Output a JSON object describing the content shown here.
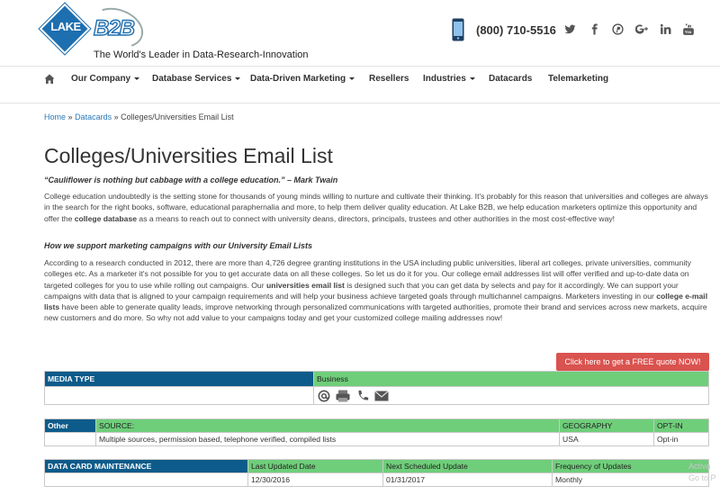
{
  "header": {
    "logo_text": "LAKE",
    "logo_b2b": "B2B",
    "tagline": "The World's Leader in Data-Research-Innovation",
    "phone": "(800) 710-5516",
    "social_icons": [
      "twitter-icon",
      "facebook-icon",
      "pinterest-icon",
      "google-plus-icon",
      "linkedin-icon",
      "youtube-icon"
    ]
  },
  "nav": {
    "items": [
      {
        "label": "Our Company",
        "dropdown": true
      },
      {
        "label": "Database Services",
        "dropdown": true
      },
      {
        "label": "Data-Driven Marketing",
        "dropdown": true
      },
      {
        "label": "Resellers",
        "dropdown": false
      },
      {
        "label": "Industries",
        "dropdown": true
      },
      {
        "label": "Datacards",
        "dropdown": false
      },
      {
        "label": "Telemarketing",
        "dropdown": false
      }
    ]
  },
  "breadcrumb": {
    "home": "Home",
    "sep": "»",
    "datacards": "Datacards",
    "current": "Colleges/Universities Email List"
  },
  "page": {
    "title": "Colleges/Universities Email List",
    "quote": "“Cauliflower is nothing but cabbage with a college education.” – Mark Twain",
    "intro_a": "College education undoubtedly is the setting stone for thousands of young minds willing to nurture and cultivate their thinking. It's probably for this reason that universities and colleges are always in the search for the right books, software, educational paraphernalia and more, to help them deliver quality education. At Lake B2B, we help education marketers optimize this opportunity and offer the ",
    "intro_bold": "college database",
    "intro_b": " as a means to reach out to connect with university deans, directors, principals, trustees and other authorities in the most cost-effective way!",
    "subheading": "How we support marketing campaigns with our University Email Lists",
    "body_a": "According to a research conducted in 2012, there are more than 4,726 degree granting institutions in the USA including public universities, liberal art colleges, private universities, community colleges etc. As a marketer it's not possible for you to get accurate data on all these colleges. So let us do it for you. Our college email addresses list will offer verified and up-to-date data on targeted colleges for you to use while rolling out campaigns. Our ",
    "body_bold1": "universities email list",
    "body_b": " is designed such that you can get data by selects and pay for it accordingly. We can support your campaigns with data that is aligned to your campaign requirements and will help your business achieve targeted goals through multichannel campaigns. Marketers investing in our ",
    "body_bold2": "college e-mail lists",
    "body_c": " have been able to generate quality leads, improve networking through personalized communications with targeted authorities, promote their brand and services across new markets, acquire new customers and do more. So why not add value to your campaigns today and get your customized college mailing addresses now!",
    "quote_button": "Click here to get a FREE quote NOW!"
  },
  "media_table": {
    "header": "MEDIA TYPE",
    "value": "Business",
    "icons": [
      "email-icon",
      "fax-icon",
      "phone-icon",
      "mail-icon"
    ]
  },
  "source_table": {
    "row_label": "Other",
    "source_header": "SOURCE:",
    "geo_header": "GEOGRAPHY",
    "optin_header": "OPT-IN",
    "source_value": "Multiple sources, permission based, telephone verified, compiled lists",
    "geo_value": "USA",
    "optin_value": "Opt-in"
  },
  "maintenance_table": {
    "header": "DATA CARD MAINTENANCE",
    "col1": "Last Updated Date",
    "col2": "Next Scheduled Update",
    "col3": "Frequency of Updates",
    "val1": "12/30/2016",
    "val2": "01/31/2017",
    "val3": "Monthly"
  },
  "overlay": {
    "line1": "Activa",
    "line2": "Go to P"
  },
  "colors": {
    "brand_blue": "#1d6fb0",
    "table_header_blue": "#0d5b8a",
    "table_header_green": "#6fce7a",
    "cta_red": "#d9534f",
    "link_blue": "#2a7ab8"
  }
}
